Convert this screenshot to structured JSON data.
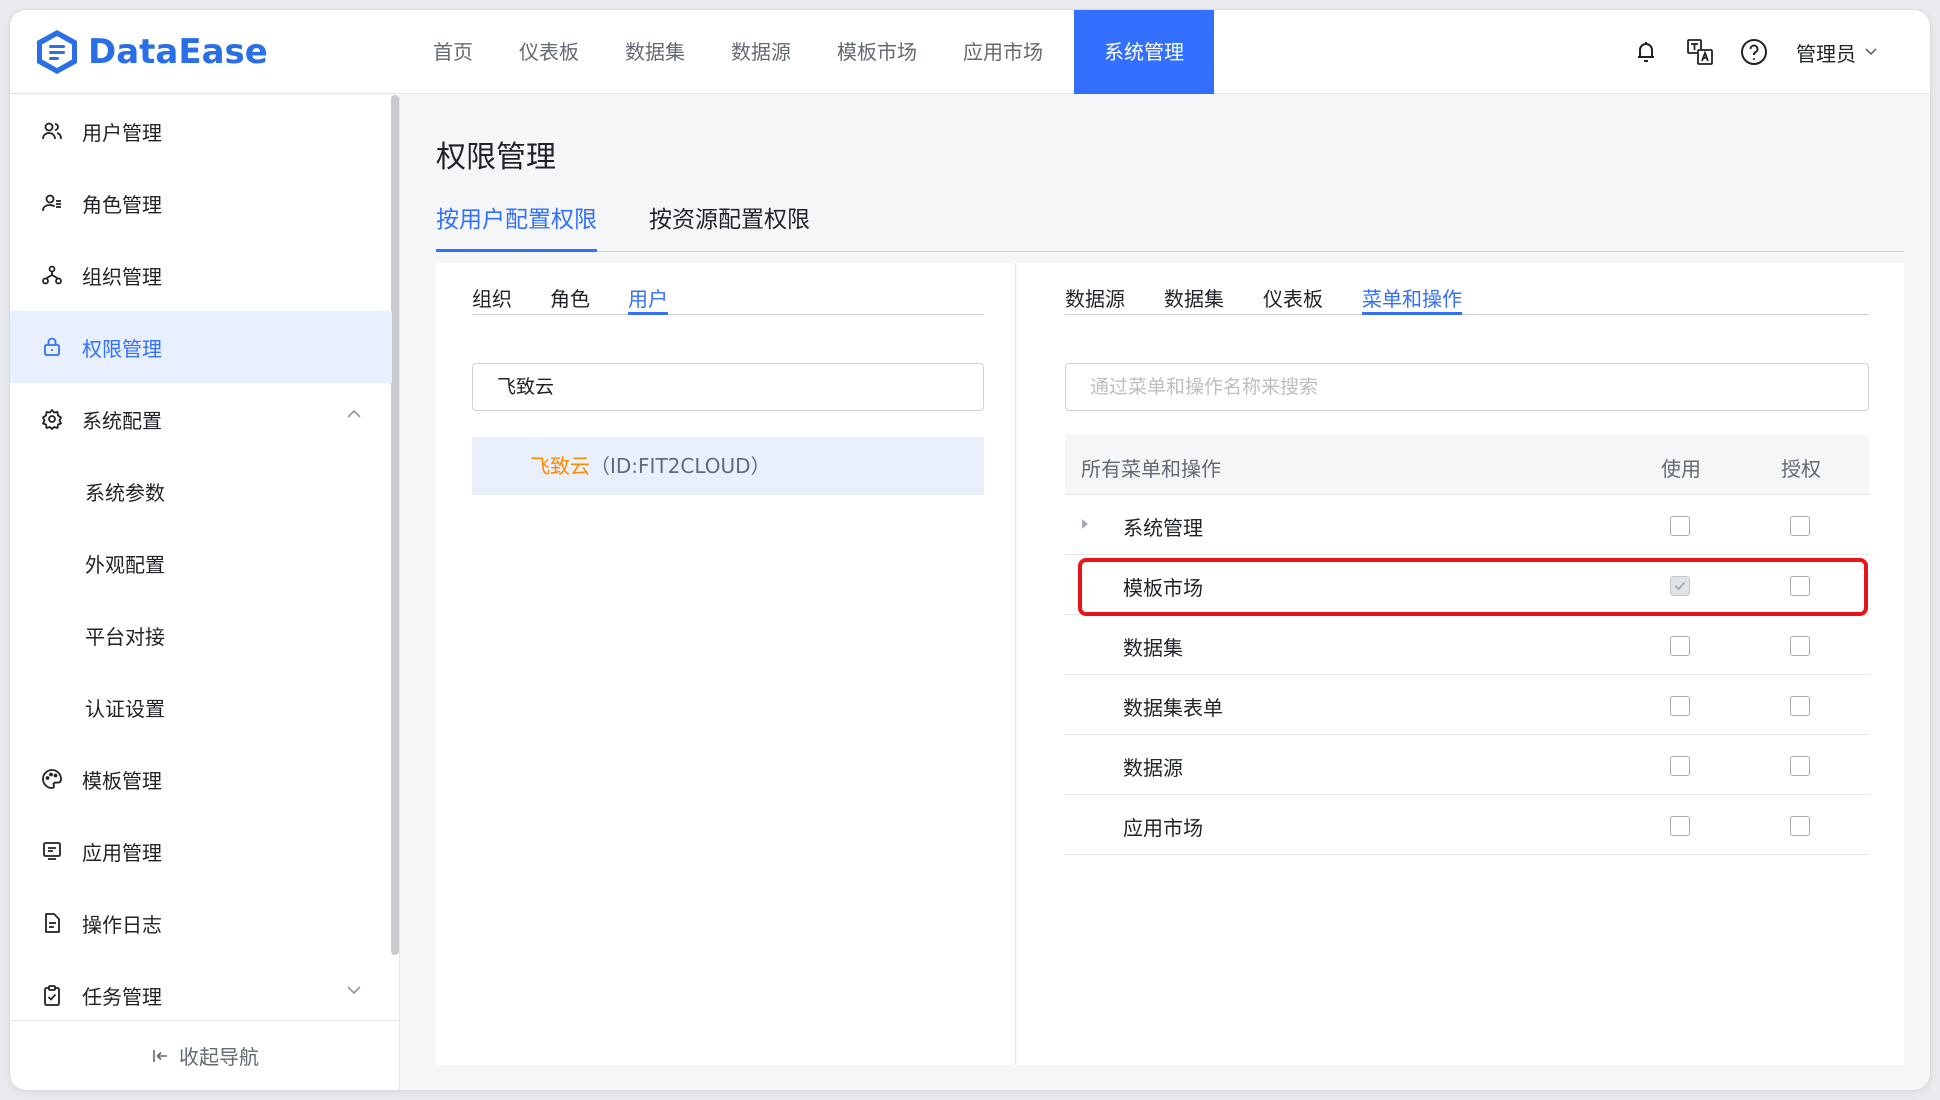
{
  "app": {
    "logo_text": "DataEase"
  },
  "nav": {
    "items": [
      "首页",
      "仪表板",
      "数据集",
      "数据源",
      "模板市场",
      "应用市场",
      "系统管理"
    ],
    "active_index": 6
  },
  "header": {
    "user_label": "管理员"
  },
  "sidebar": {
    "items": [
      {
        "label": "用户管理",
        "icon": "users-icon"
      },
      {
        "label": "角色管理",
        "icon": "role-icon"
      },
      {
        "label": "组织管理",
        "icon": "org-tree-icon"
      },
      {
        "label": "权限管理",
        "icon": "lock-icon"
      },
      {
        "label": "系统配置",
        "icon": "gear-icon"
      },
      {
        "label": "系统参数"
      },
      {
        "label": "外观配置"
      },
      {
        "label": "平台对接"
      },
      {
        "label": "认证设置"
      },
      {
        "label": "模板管理",
        "icon": "palette-icon"
      },
      {
        "label": "应用管理",
        "icon": "app-icon"
      },
      {
        "label": "操作日志",
        "icon": "log-icon"
      },
      {
        "label": "任务管理",
        "icon": "clipboard-icon"
      }
    ],
    "active_index": 3,
    "collapse_label": "收起导航"
  },
  "main": {
    "title": "权限管理",
    "tabs": [
      "按用户配置权限",
      "按资源配置权限"
    ],
    "active_tab": 0
  },
  "left_panel": {
    "tabs": [
      "组织",
      "角色",
      "用户"
    ],
    "active_tab": 2,
    "search_value": "飞致云",
    "selected_user": {
      "name": "飞致云",
      "id_text": "（ID:FIT2CLOUD）"
    }
  },
  "right_panel": {
    "tabs": [
      "数据源",
      "数据集",
      "仪表板",
      "菜单和操作"
    ],
    "active_tab": 3,
    "search_placeholder": "通过菜单和操作名称来搜索",
    "table": {
      "headers": [
        "所有菜单和操作",
        "使用",
        "授权"
      ],
      "rows": [
        {
          "label": "系统管理",
          "expandable": true,
          "use": false,
          "auth": false
        },
        {
          "label": "模板市场",
          "expandable": false,
          "use": true,
          "use_disabled": true,
          "auth": false,
          "highlighted": true
        },
        {
          "label": "数据集",
          "expandable": false,
          "use": false,
          "auth": false
        },
        {
          "label": "数据集表单",
          "expandable": false,
          "use": false,
          "auth": false
        },
        {
          "label": "数据源",
          "expandable": false,
          "use": false,
          "auth": false
        },
        {
          "label": "应用市场",
          "expandable": false,
          "use": false,
          "auth": false
        }
      ]
    }
  },
  "colors": {
    "primary": "#3370ff",
    "accent_orange": "#ff8800",
    "highlight_red": "#e8141c"
  }
}
